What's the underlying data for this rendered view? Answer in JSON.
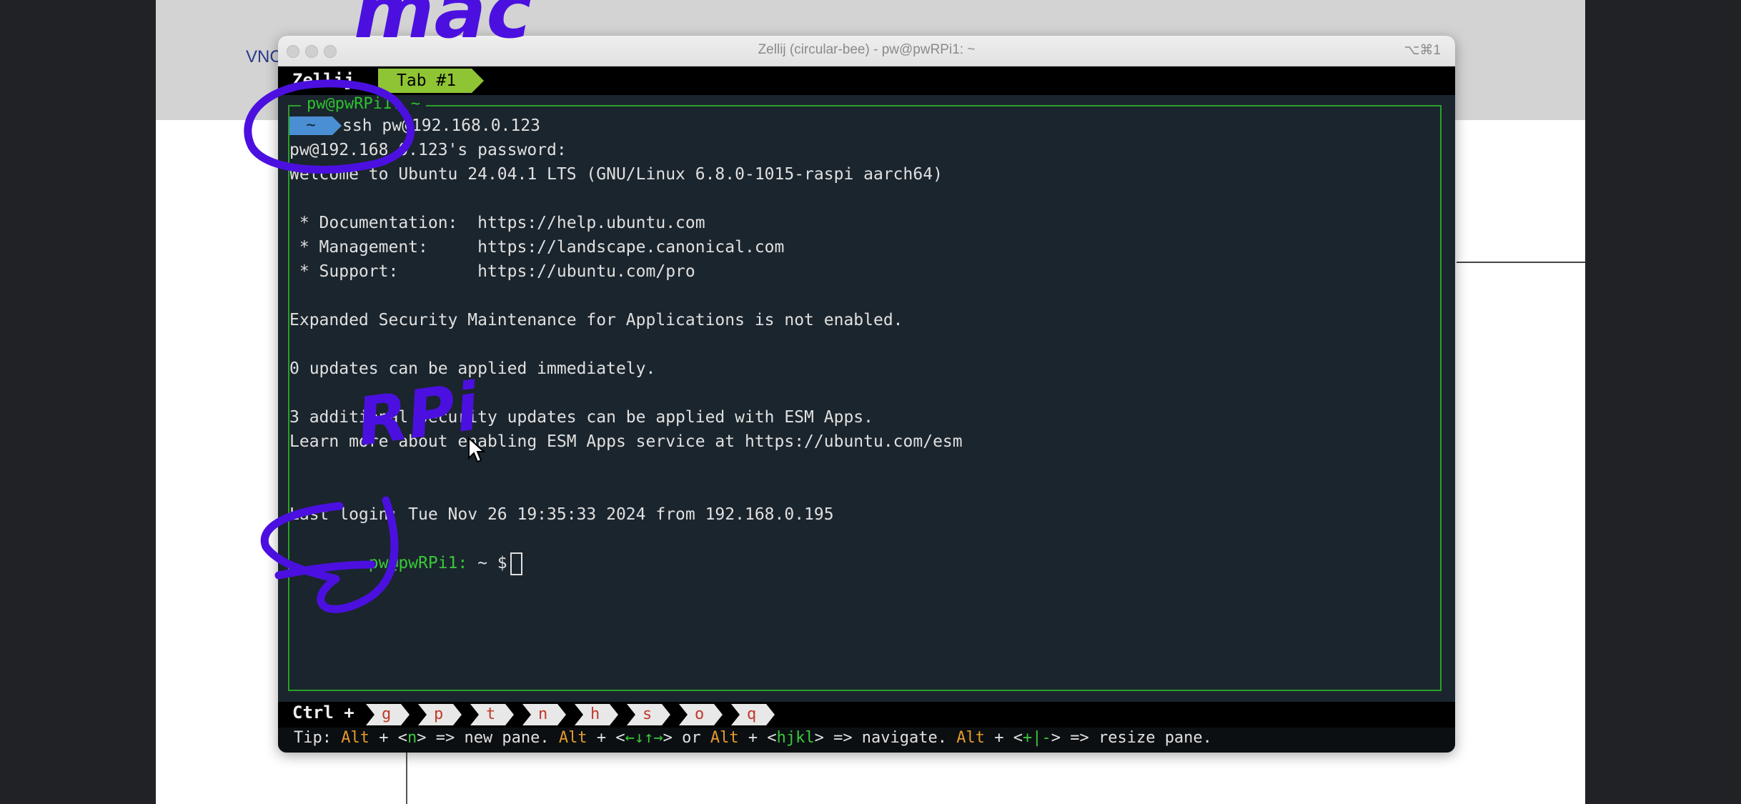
{
  "desktop": {
    "vnc_label": "VNC"
  },
  "window": {
    "title": "Zellij (circular-bee) - pw@pwRPi1: ~",
    "shortcut": "⌥⌘1"
  },
  "tabbar": {
    "app_name": "Zellij",
    "tabs": [
      {
        "label": "Tab #1"
      }
    ]
  },
  "pane": {
    "title": "pw@pwRPi1: ~"
  },
  "terminal": {
    "prompt_chip": "~",
    "ssh_command": "ssh pw@192.168.0.123",
    "lines": [
      "pw@192.168.0.123's password:",
      "Welcome to Ubuntu 24.04.1 LTS (GNU/Linux 6.8.0-1015-raspi aarch64)",
      "",
      " * Documentation:  https://help.ubuntu.com",
      " * Management:     https://landscape.canonical.com",
      " * Support:        https://ubuntu.com/pro",
      "",
      "Expanded Security Maintenance for Applications is not enabled.",
      "",
      "0 updates can be applied immediately.",
      "",
      "3 additional security updates can be applied with ESM Apps.",
      "Learn more about enabling ESM Apps service at https://ubuntu.com/esm",
      "",
      "",
      "Last login: Tue Nov 26 19:35:33 2024 from 192.168.0.195"
    ],
    "final_prompt_user": "pw@pwRPi1:",
    "final_prompt_rest": " ~ $"
  },
  "statusbar": {
    "ctrl_label": "Ctrl +",
    "keys": [
      "g",
      "p",
      "t",
      "n",
      "h",
      "s",
      "o",
      "q"
    ]
  },
  "tip": {
    "prefix": "Tip: ",
    "alt1": "Alt",
    "part1": " + <",
    "key1": "n",
    "part2": "> => new pane. ",
    "alt2": "Alt",
    "part3": " + <",
    "key2": "←↓↑→",
    "part4": "> or ",
    "alt3": "Alt",
    "part5": " + <",
    "key3": "hjkl",
    "part6": "> => navigate. ",
    "alt4": "Alt",
    "part7": " + <",
    "key4": "+|-",
    "part8": "> => resize pane."
  },
  "annotations": {
    "color": "#4b10e0",
    "mac_text": "mac",
    "rpi_text": "RPi"
  }
}
